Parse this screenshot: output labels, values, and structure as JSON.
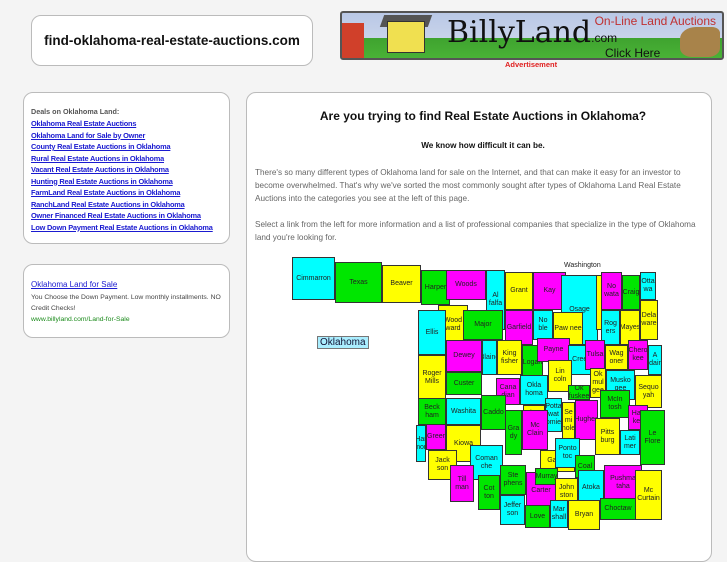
{
  "header": {
    "site_title": "find-oklahoma-real-estate-auctions.com"
  },
  "banner": {
    "logo": "BillyLand",
    "logo_suffix": ".com",
    "tagline": "On-Line Land Auctions",
    "cta": "Click Here",
    "ad_label": "Advertisement"
  },
  "sidebar": {
    "heading": "Deals on Oklahoma Land:",
    "links": [
      "Oklahoma Real Estate Auctions",
      "Oklahoma Land for Sale by Owner",
      "County Real Estate Auctions in Oklahoma",
      "Rural Real Estate Auctions in Oklahoma",
      "Vacant Real Estate Auctions in Oklahoma",
      "Hunting Real Estate Auctions in Oklahoma",
      "FarmLand Real Estate Auctions in Oklahoma",
      "RanchLand Real Estate Auctions in Oklahoma",
      "Owner Financed Real Estate Auctions in Oklahoma",
      "Low Down Payment Real Estate Auctions in Oklahoma"
    ]
  },
  "ad": {
    "title": "Oklahoma Land for Sale",
    "text": "You Choose the Down Payment. Low monthly installments. NO Credit Checks!",
    "url": "www.billyland.com/Land-for-Sale"
  },
  "main": {
    "title": "Are you trying to find Real Estate Auctions in Oklahoma?",
    "subtitle": "We know how difficult it can be.",
    "para1": "There's so many different types of Oklahoma land for sale on the Internet, and that can make it easy for an investor to become overwhelmed. That's why we've sorted the most commonly sought after types of Oklahoma Land Real Estate Auctions into the categories you see at the left of this page.",
    "para2": "Select a link from the left for more information and a list of professional companies that specialize in the type of Oklahoma land you're looking for."
  },
  "map": {
    "state_label": "Oklahoma",
    "callout": "Washington",
    "colors": {
      "c": "#00ffff",
      "g": "#00e600",
      "y": "#ffff00",
      "m": "#ff00ff"
    },
    "counties": [
      {
        "name": "Cimmarron",
        "color": "c"
      },
      {
        "name": "Texas",
        "color": "g"
      },
      {
        "name": "Beaver",
        "color": "y"
      },
      {
        "name": "Harper",
        "color": "g"
      },
      {
        "name": "Woods",
        "color": "m"
      },
      {
        "name": "Al falfa",
        "color": "c"
      },
      {
        "name": "Grant",
        "color": "y"
      },
      {
        "name": "Kay",
        "color": "m"
      },
      {
        "name": "Osage",
        "color": "c"
      },
      {
        "name": "Washington",
        "color": "y"
      },
      {
        "name": "No wata",
        "color": "m"
      },
      {
        "name": "Craig",
        "color": "g"
      },
      {
        "name": "Otta wa",
        "color": "c"
      },
      {
        "name": "Wood ward",
        "color": "y"
      },
      {
        "name": "Major",
        "color": "g"
      },
      {
        "name": "Garfield",
        "color": "m"
      },
      {
        "name": "No ble",
        "color": "c"
      },
      {
        "name": "Paw nee",
        "color": "y"
      },
      {
        "name": "Rog ers",
        "color": "c"
      },
      {
        "name": "Mayes",
        "color": "y"
      },
      {
        "name": "Dela ware",
        "color": "y"
      },
      {
        "name": "Ellis",
        "color": "c"
      },
      {
        "name": "Dewey",
        "color": "m"
      },
      {
        "name": "Blaine",
        "color": "c"
      },
      {
        "name": "King fisher",
        "color": "y"
      },
      {
        "name": "Logan",
        "color": "g"
      },
      {
        "name": "Payne",
        "color": "m"
      },
      {
        "name": "Creek",
        "color": "c"
      },
      {
        "name": "Tulsa",
        "color": "m"
      },
      {
        "name": "Wag oner",
        "color": "y"
      },
      {
        "name": "Chero kee",
        "color": "m"
      },
      {
        "name": "A dair",
        "color": "c"
      },
      {
        "name": "Roger Mills",
        "color": "y"
      },
      {
        "name": "Custer",
        "color": "g"
      },
      {
        "name": "Cana dian",
        "color": "m"
      },
      {
        "name": "Okla homa",
        "color": "c"
      },
      {
        "name": "Lin coln",
        "color": "y"
      },
      {
        "name": "Ok fuskee",
        "color": "g"
      },
      {
        "name": "Ok mul gee",
        "color": "y"
      },
      {
        "name": "Musko gee",
        "color": "c"
      },
      {
        "name": "Sequo yah",
        "color": "y"
      },
      {
        "name": "Beck ham",
        "color": "g"
      },
      {
        "name": "Washita",
        "color": "c"
      },
      {
        "name": "Caddo",
        "color": "g"
      },
      {
        "name": "Cleve land",
        "color": "y"
      },
      {
        "name": "Potta wat omie",
        "color": "c"
      },
      {
        "name": "Se mi nole",
        "color": "y"
      },
      {
        "name": "Hughes",
        "color": "m"
      },
      {
        "name": "McIn tosh",
        "color": "g"
      },
      {
        "name": "Has kell",
        "color": "m"
      },
      {
        "name": "Har mon",
        "color": "c"
      },
      {
        "name": "Greer",
        "color": "m"
      },
      {
        "name": "Kiowa",
        "color": "y"
      },
      {
        "name": "Gra dy",
        "color": "g"
      },
      {
        "name": "Mc Clain",
        "color": "m"
      },
      {
        "name": "Pitts burg",
        "color": "y"
      },
      {
        "name": "Lati mer",
        "color": "c"
      },
      {
        "name": "Le Flore",
        "color": "g"
      },
      {
        "name": "Jack son",
        "color": "y"
      },
      {
        "name": "Coman che",
        "color": "c"
      },
      {
        "name": "Garvin",
        "color": "y"
      },
      {
        "name": "Ponto toc",
        "color": "c"
      },
      {
        "name": "Coal",
        "color": "g"
      },
      {
        "name": "Till man",
        "color": "m"
      },
      {
        "name": "Cot ton",
        "color": "g"
      },
      {
        "name": "Ste phens",
        "color": "g"
      },
      {
        "name": "Carter",
        "color": "m"
      },
      {
        "name": "Murray",
        "color": "g"
      },
      {
        "name": "John ston",
        "color": "y"
      },
      {
        "name": "Atoka",
        "color": "c"
      },
      {
        "name": "Pushma taha",
        "color": "m"
      },
      {
        "name": "Mc Curtain",
        "color": "y"
      },
      {
        "name": "Jeffer son",
        "color": "c"
      },
      {
        "name": "Love",
        "color": "g"
      },
      {
        "name": "Mar shall",
        "color": "c"
      },
      {
        "name": "Bryan",
        "color": "y"
      },
      {
        "name": "Choctaw",
        "color": "g"
      }
    ]
  }
}
